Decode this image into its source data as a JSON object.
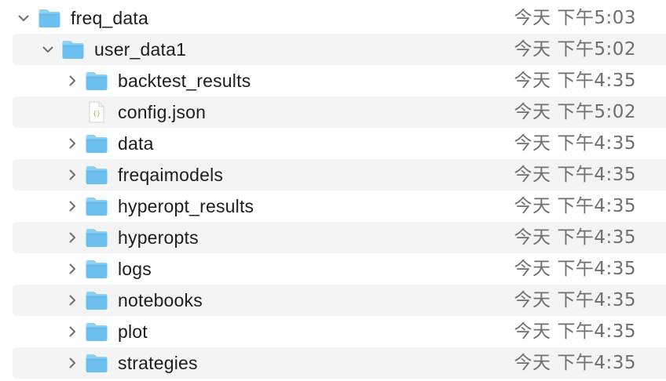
{
  "colors": {
    "folder_body": "#6cc0ef",
    "folder_tab": "#8fd0f5",
    "row_stripe": "#f4f4f5",
    "date_text": "#6e6e73"
  },
  "rows": [
    {
      "name": "freq_data",
      "date": "今天 下午5:03",
      "kind": "folder",
      "expanded": true,
      "level": 0,
      "icon": "folder-icon"
    },
    {
      "name": "user_data1",
      "date": "今天 下午5:02",
      "kind": "folder",
      "expanded": true,
      "level": 1,
      "icon": "folder-icon"
    },
    {
      "name": "backtest_results",
      "date": "今天 下午4:35",
      "kind": "folder",
      "expanded": false,
      "level": 2,
      "icon": "folder-icon"
    },
    {
      "name": "config.json",
      "date": "今天 下午5:02",
      "kind": "file",
      "level": 2,
      "icon": "json-file-icon",
      "icon_text": "{}"
    },
    {
      "name": "data",
      "date": "今天 下午4:35",
      "kind": "folder",
      "expanded": false,
      "level": 2,
      "icon": "folder-icon"
    },
    {
      "name": "freqaimodels",
      "date": "今天 下午4:35",
      "kind": "folder",
      "expanded": false,
      "level": 2,
      "icon": "folder-icon"
    },
    {
      "name": "hyperopt_results",
      "date": "今天 下午4:35",
      "kind": "folder",
      "expanded": false,
      "level": 2,
      "icon": "folder-icon"
    },
    {
      "name": "hyperopts",
      "date": "今天 下午4:35",
      "kind": "folder",
      "expanded": false,
      "level": 2,
      "icon": "folder-icon"
    },
    {
      "name": "logs",
      "date": "今天 下午4:35",
      "kind": "folder",
      "expanded": false,
      "level": 2,
      "icon": "folder-icon"
    },
    {
      "name": "notebooks",
      "date": "今天 下午4:35",
      "kind": "folder",
      "expanded": false,
      "level": 2,
      "icon": "folder-icon"
    },
    {
      "name": "plot",
      "date": "今天 下午4:35",
      "kind": "folder",
      "expanded": false,
      "level": 2,
      "icon": "folder-icon"
    },
    {
      "name": "strategies",
      "date": "今天 下午4:35",
      "kind": "folder",
      "expanded": false,
      "level": 2,
      "icon": "folder-icon"
    }
  ]
}
